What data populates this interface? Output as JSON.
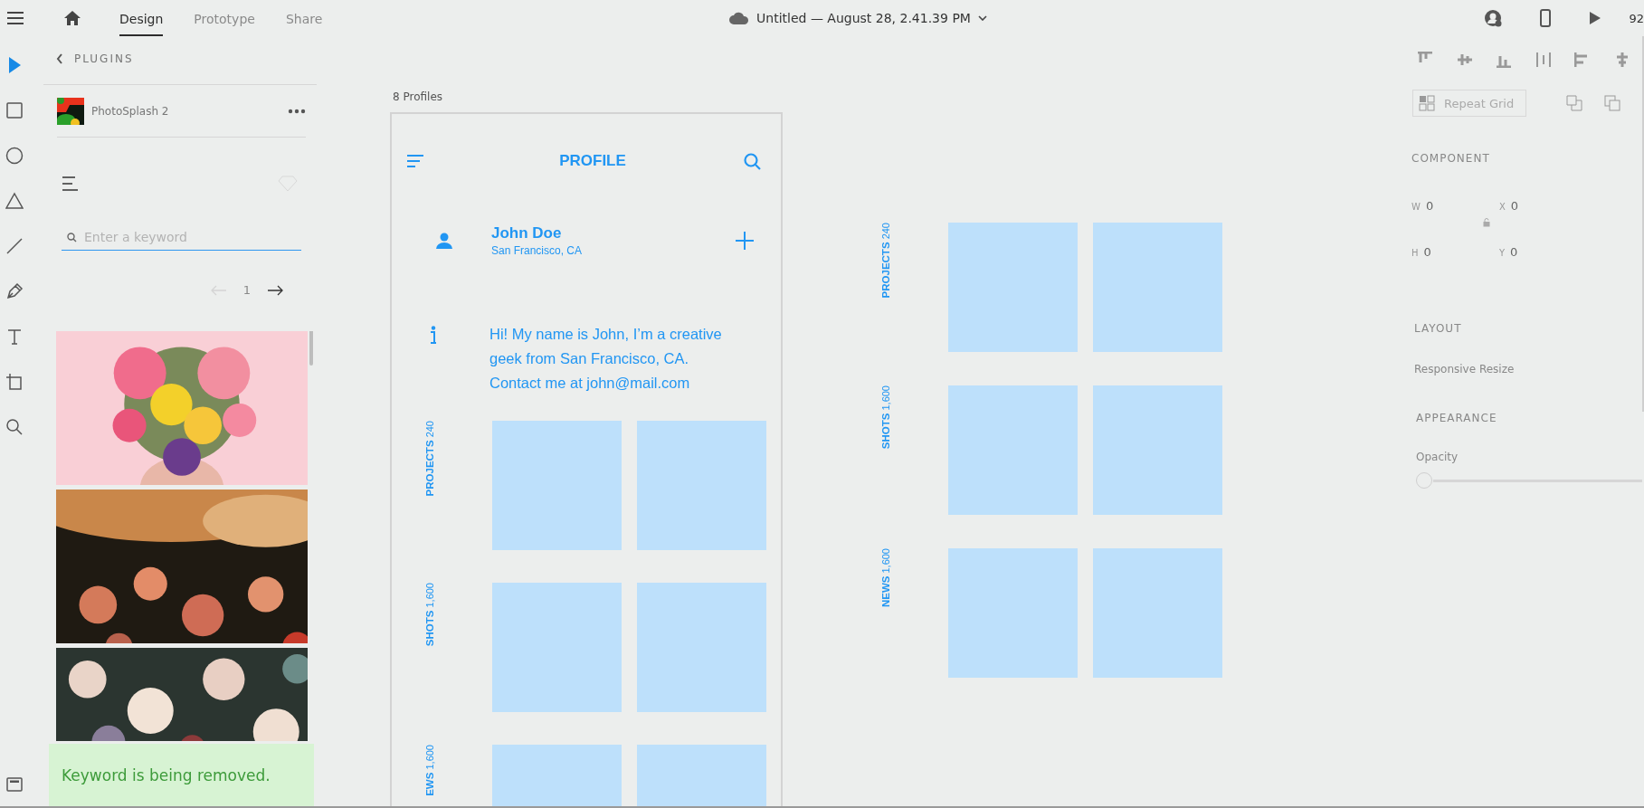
{
  "top_bar": {
    "tabs": [
      {
        "label": "Design",
        "selected": true
      },
      {
        "label": "Prototype",
        "selected": false
      },
      {
        "label": "Share",
        "selected": false
      }
    ],
    "document_title": "Untitled — August 28, 2.41.39 PM",
    "zoom": "92"
  },
  "tools": [
    {
      "kind": "select",
      "selected": true
    },
    {
      "kind": "rectangle",
      "selected": false
    },
    {
      "kind": "ellipse",
      "selected": false
    },
    {
      "kind": "polygon",
      "selected": false
    },
    {
      "kind": "line",
      "selected": false
    },
    {
      "kind": "pen",
      "selected": false
    },
    {
      "kind": "text",
      "selected": false
    },
    {
      "kind": "artboard",
      "selected": false
    },
    {
      "kind": "zoom",
      "selected": false
    }
  ],
  "plugins_panel": {
    "header": "PLUGINS",
    "plugin_name": "PhotoSplash 2",
    "search": {
      "placeholder": "Enter a keyword"
    },
    "page": "1",
    "toast": "Keyword is being removed."
  },
  "canvas": {
    "artboards": [
      {
        "kind": "mobile",
        "title": "8 Profiles",
        "app_title": "PROFILE",
        "name": "John Doe",
        "location": "San Francisco, CA",
        "bio": "Hi! My name is John, I’m a creative geek from San Francisco, CA. Contact me at john@mail.com",
        "sections": [
          {
            "label": "PROJECTS",
            "count": "240"
          },
          {
            "label": "SHOTS",
            "count": "1,600"
          },
          {
            "label": "EWS",
            "count": "1,600"
          }
        ]
      },
      {
        "kind": "grid",
        "sections": [
          {
            "label": "PROJECTS",
            "count": "240"
          },
          {
            "label": "SHOTS",
            "count": "1,600"
          },
          {
            "label": "NEWS",
            "count": "1,600"
          }
        ]
      }
    ]
  },
  "property_panel": {
    "repeat_grid": "Repeat Grid",
    "component_heading": "COMPONENT",
    "fields": [
      {
        "label": "W",
        "value": "0"
      },
      {
        "label": "X",
        "value": "0"
      },
      {
        "label": "H",
        "value": "0"
      },
      {
        "label": "Y",
        "value": "0"
      }
    ],
    "layout_heading": "LAYOUT",
    "responsive_resize": "Responsive Resize",
    "appearance_heading": "APPEARANCE",
    "opacity": {
      "label": "Opacity",
      "level": 0
    }
  }
}
